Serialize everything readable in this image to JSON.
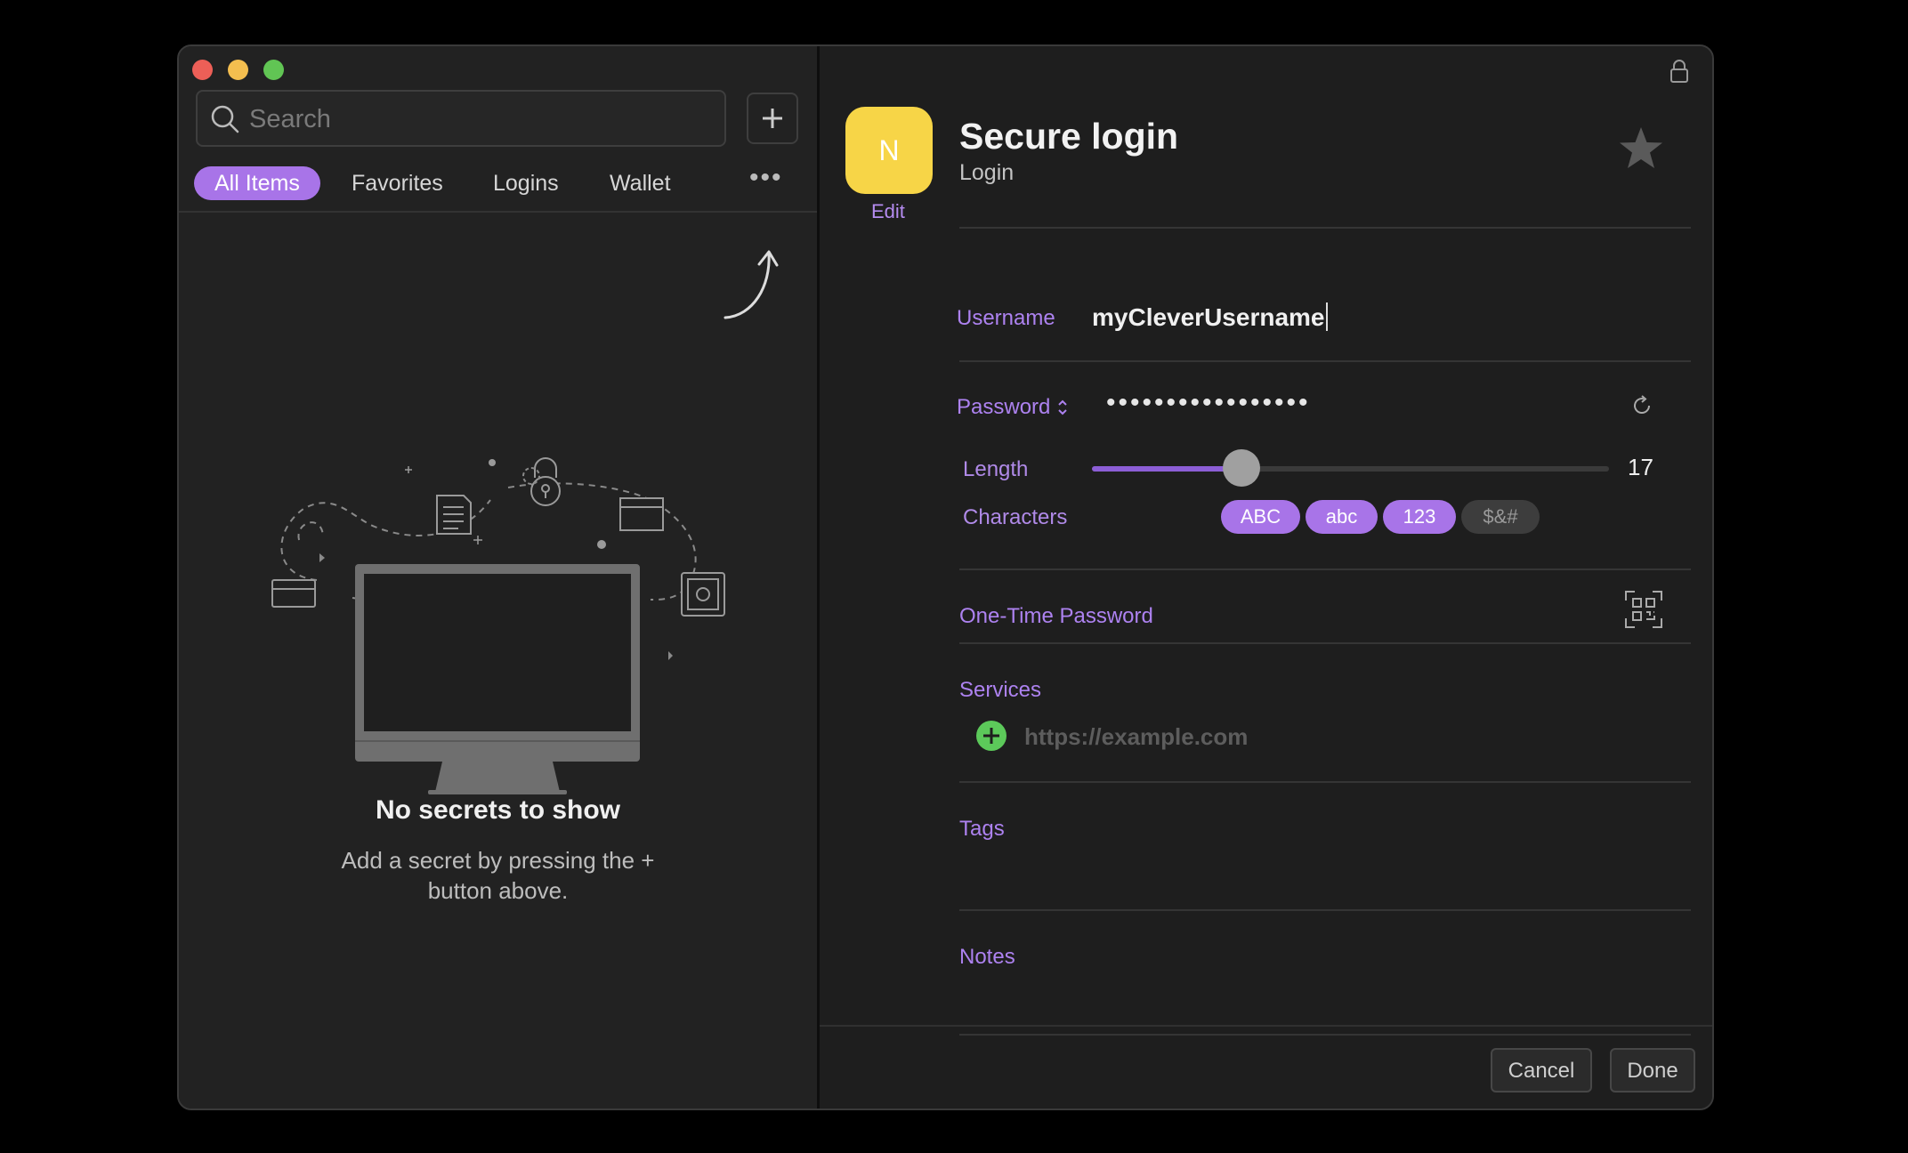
{
  "sidebar": {
    "search_placeholder": "Search",
    "filters": [
      "All Items",
      "Favorites",
      "Logins",
      "Wallet"
    ],
    "more_label": "•••",
    "empty_title": "No secrets to show",
    "empty_subtitle": "Add a secret by pressing the + button above."
  },
  "item": {
    "avatar_letter": "N",
    "edit_label": "Edit",
    "title": "Secure login",
    "type": "Login",
    "username_label": "Username",
    "username_value": "myCleverUsername",
    "password_label": "Password",
    "password_mask": "•••••••••••••••••",
    "length_label": "Length",
    "length_value": "17",
    "length_fraction": 0.29,
    "characters_label": "Characters",
    "character_sets": [
      {
        "label": "ABC",
        "enabled": true
      },
      {
        "label": "abc",
        "enabled": true
      },
      {
        "label": "123",
        "enabled": true
      },
      {
        "label": "$&#",
        "enabled": false
      }
    ],
    "otp_label": "One-Time Password",
    "services_label": "Services",
    "service_placeholder": "https://example.com",
    "tags_label": "Tags",
    "notes_label": "Notes"
  },
  "footer": {
    "cancel_label": "Cancel",
    "done_label": "Done"
  },
  "colors": {
    "accent": "#a874e8",
    "avatar": "#f7d547",
    "add_green": "#5cc95a"
  }
}
